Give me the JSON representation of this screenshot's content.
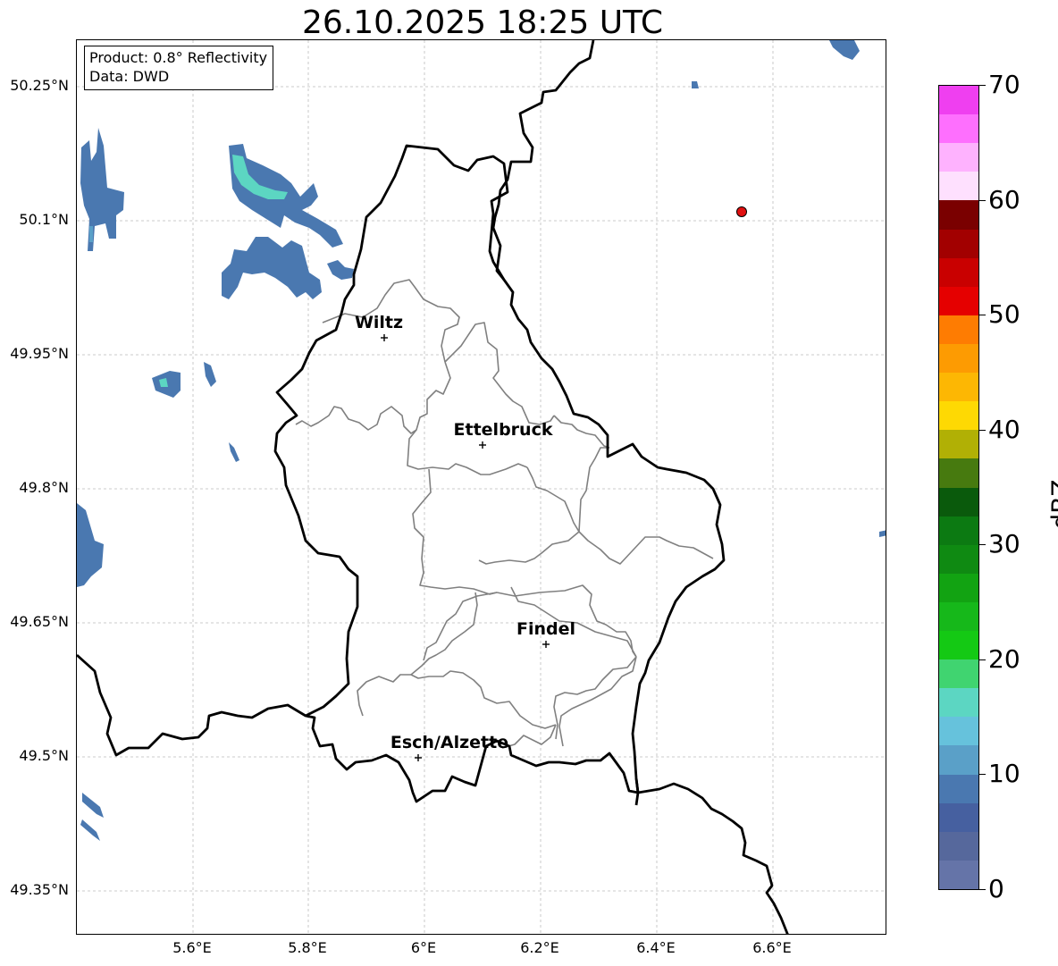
{
  "title": "26.10.2025 18:25 UTC",
  "info_box": {
    "product": "Product: 0.8° Reflectivity",
    "data": "Data: DWD"
  },
  "lat_labels": [
    "50.25°N",
    "50.1°N",
    "49.95°N",
    "49.8°N",
    "49.65°N",
    "49.5°N",
    "49.35°N"
  ],
  "lon_labels": [
    "5.6°E",
    "5.8°E",
    "6°E",
    "6.2°E",
    "6.4°E",
    "6.6°E"
  ],
  "cities": [
    {
      "name": "Wiltz"
    },
    {
      "name": "Ettelbruck"
    },
    {
      "name": "Findel"
    },
    {
      "name": "Esch/Alzette"
    }
  ],
  "colorbar": {
    "label": "dBZ",
    "min": 0,
    "max": 70,
    "step": 2.5,
    "ticks": [
      "0",
      "10",
      "20",
      "30",
      "40",
      "50",
      "60",
      "70"
    ],
    "colors": [
      "#6574a8",
      "#56689c",
      "#4660a0",
      "#4a78b0",
      "#5aa0c8",
      "#66c2dc",
      "#5cd6c2",
      "#40d470",
      "#14c914",
      "#16b81a",
      "#12a312",
      "#0f8a12",
      "#0c7a12",
      "#0a5a0c",
      "#477a0f",
      "#b1b005",
      "#fed903",
      "#fdb703",
      "#fd9b02",
      "#fe7c02",
      "#e50000",
      "#c90000",
      "#a20000",
      "#7a0000",
      "#fee0fe",
      "#feb2fe",
      "#fe6ffe",
      "#ef3ff0"
    ]
  },
  "marker_colors": {
    "radar_point": "#e01010",
    "national_border": "#000000",
    "district_border": "#808080",
    "grid": "#bbbbbb"
  }
}
